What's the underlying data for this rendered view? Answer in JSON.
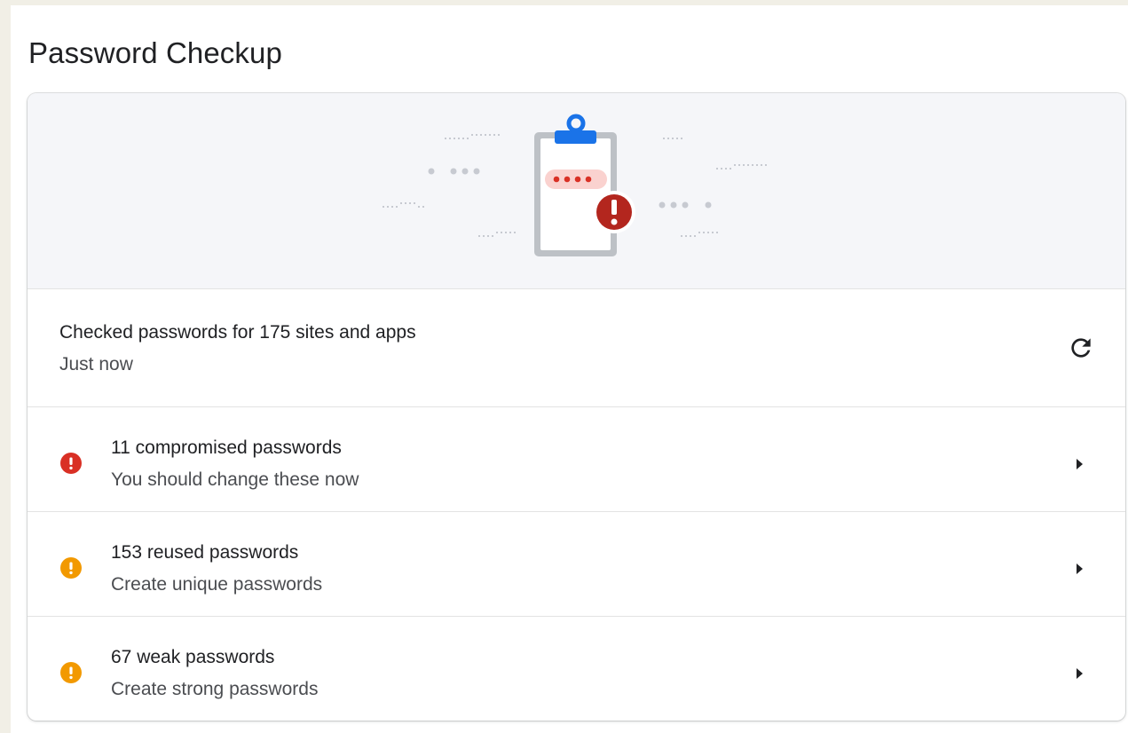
{
  "page": {
    "title": "Password Checkup"
  },
  "summary": {
    "title": "Checked passwords for 175 sites and apps",
    "subtitle": "Just now",
    "refresh_icon": "refresh-icon"
  },
  "issues": [
    {
      "title": "11 compromised passwords",
      "subtitle": "You should change these now",
      "severity": "error",
      "icon": "error-icon",
      "color": "#d93025"
    },
    {
      "title": "153 reused passwords",
      "subtitle": "Create unique passwords",
      "severity": "warning",
      "icon": "warning-icon",
      "color": "#f29900"
    },
    {
      "title": "67 weak passwords",
      "subtitle": "Create strong passwords",
      "severity": "warning",
      "icon": "warning-icon",
      "color": "#f29900"
    }
  ],
  "illustration": {
    "icon": "clipboard-alert-icon",
    "accent_color": "#1a73e8",
    "alert_color": "#b3261e"
  },
  "colors": {
    "background": "#f1efe6",
    "card": "#ffffff",
    "banner": "#f5f6f9",
    "error": "#d93025",
    "warning": "#f29900"
  }
}
